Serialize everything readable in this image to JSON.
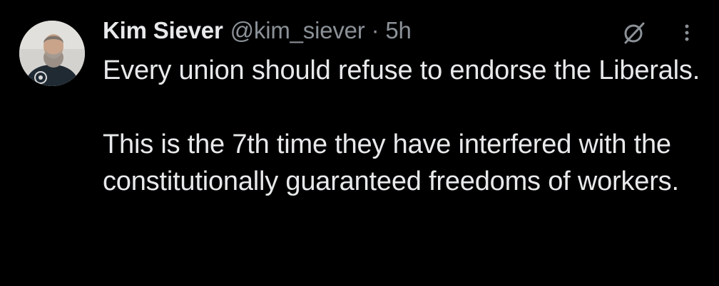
{
  "tweet": {
    "author_name": "Kim Siever",
    "author_handle": "@kim_siever",
    "separator": "·",
    "time": "5h",
    "paragraphs": [
      "Every union should refuse to endorse the Liberals.",
      "This is the 7th time they have interfered with the constitutionally guaranteed freedoms of workers."
    ]
  },
  "icons": {
    "avatar": "profile-photo",
    "grok": "grok-icon",
    "more": "more-vertical-icon"
  },
  "colors": {
    "background": "#000000",
    "text_primary": "#e7e9ea",
    "text_secondary": "#8b9197"
  }
}
